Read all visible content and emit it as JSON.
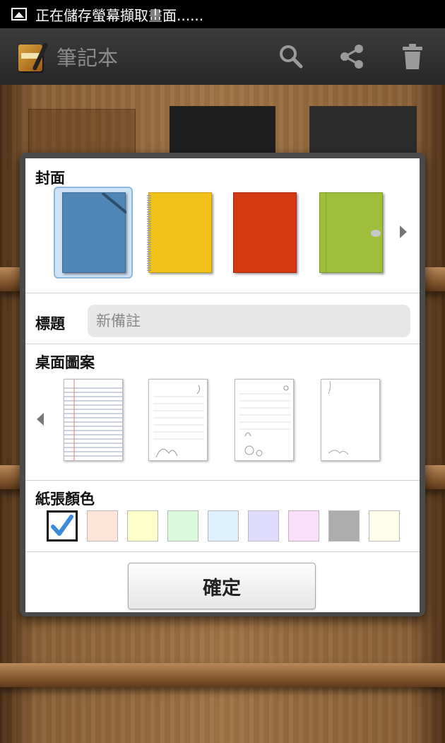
{
  "status_bar": {
    "text": "正在儲存螢幕擷取畫面......",
    "icon": "screenshot-image-icon"
  },
  "action_bar": {
    "title": "筆記本",
    "actions": [
      {
        "name": "search-icon"
      },
      {
        "name": "share-icon"
      },
      {
        "name": "trash-icon"
      }
    ]
  },
  "dialog": {
    "cover_section": {
      "label": "封面",
      "covers": [
        {
          "color": "#4f86b6",
          "style": "plain",
          "selected": true
        },
        {
          "color": "#f1c21a",
          "style": "spiral",
          "selected": false
        },
        {
          "color": "#d33a14",
          "style": "plain",
          "selected": false
        },
        {
          "color": "#9fbf3c",
          "style": "clasp",
          "selected": false
        }
      ]
    },
    "title_section": {
      "label": "標題",
      "placeholder": "新備註"
    },
    "pattern_section": {
      "label": "桌面圖案",
      "patterns": [
        "lined",
        "floral-1",
        "floral-2",
        "floral-3"
      ]
    },
    "color_section": {
      "label": "紙張顏色",
      "colors": [
        "#ffffff",
        "#ffe5d8",
        "#ffffcc",
        "#dbfadb",
        "#dcf1fb",
        "#dedcfa",
        "#fbdffa",
        "#adadad",
        "#fffdec"
      ],
      "selected_index": 0,
      "check_color": "#3b8bd8"
    },
    "confirm_label": "確定"
  }
}
